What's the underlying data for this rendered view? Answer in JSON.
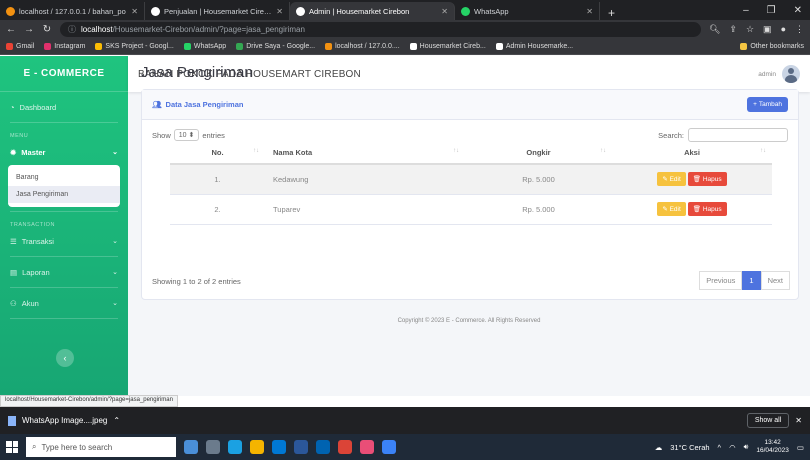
{
  "browser": {
    "tabs": [
      {
        "label": "localhost / 127.0.0.1 / bahan_po",
        "color": "#f29111",
        "active": false
      },
      {
        "label": "Penjualan | Housemarket Cirebon",
        "color": "#ffffff",
        "active": false
      },
      {
        "label": "Admin | Housemarket Cirebon",
        "color": "#ffffff",
        "active": true
      },
      {
        "label": "WhatsApp",
        "color": "#25d366",
        "active": false
      }
    ],
    "url_host": "localhost",
    "url_path": "/Housemarket-Cirebon/admin/?page=jasa_pengiriman",
    "bookmarks": [
      {
        "label": "Gmail",
        "color": "#ea4335"
      },
      {
        "label": "Instagram",
        "color": "#e1306c"
      },
      {
        "label": "SKS Project - Googl...",
        "color": "#fbbc04"
      },
      {
        "label": "WhatsApp",
        "color": "#25d366"
      },
      {
        "label": "Drive Saya - Google...",
        "color": "#34a853"
      },
      {
        "label": "localhost / 127.0.0....",
        "color": "#f29111"
      },
      {
        "label": "Housemarket Cireb...",
        "color": "#ffffff"
      },
      {
        "label": "Admin Housemarke...",
        "color": "#ffffff"
      }
    ],
    "other_bookmarks": "Other bookmarks",
    "status_url": "localhost/Housemarket-Cirebon/admin/?page=jasa_pengiriman"
  },
  "sidebar": {
    "brand": "E - COMMERCE",
    "dashboard": "Dashboard",
    "menu_heading": "MENU",
    "master": "Master",
    "sub_items": [
      "Barang",
      "Jasa Pengiriman"
    ],
    "transaction_heading": "TRANSACTION",
    "transaksi": "Transaksi",
    "laporan": "Laporan",
    "akun": "Akun"
  },
  "topbar": {
    "title": "BAHAN POKOK PADA HOUSEMART CIREBON",
    "user": "admin"
  },
  "page": {
    "title": "Jasa Pengiriman",
    "card_title": "Data Jasa Pengiriman",
    "add_button": "Tambah",
    "show_label": "Show",
    "entries_value": "10",
    "entries_label": "entries",
    "search_label": "Search:",
    "columns": [
      "No.",
      "Nama Kota",
      "Ongkir",
      "Aksi"
    ],
    "rows": [
      {
        "no": "1.",
        "kota": "Kedawung",
        "ongkir": "Rp. 5.000"
      },
      {
        "no": "2.",
        "kota": "Tuparev",
        "ongkir": "Rp. 5.000"
      }
    ],
    "edit_label": "Edit",
    "hapus_label": "Hapus",
    "info": "Showing 1 to 2 of 2 entries",
    "prev": "Previous",
    "current_page": "1",
    "next": "Next"
  },
  "footer": "Copyright © 2023 E - Commerce. All Rights Reserved",
  "downloads": {
    "file": "WhatsApp Image....jpeg",
    "show_all": "Show all"
  },
  "taskbar": {
    "search_placeholder": "Type here to search",
    "weather": "31°C Cerah",
    "time": "13:42",
    "date": "16/04/2023"
  },
  "colors": {
    "sidebar": "#1cc88a",
    "primary": "#4e73df",
    "edit": "#f6c23e",
    "hapus": "#e74a3b"
  }
}
